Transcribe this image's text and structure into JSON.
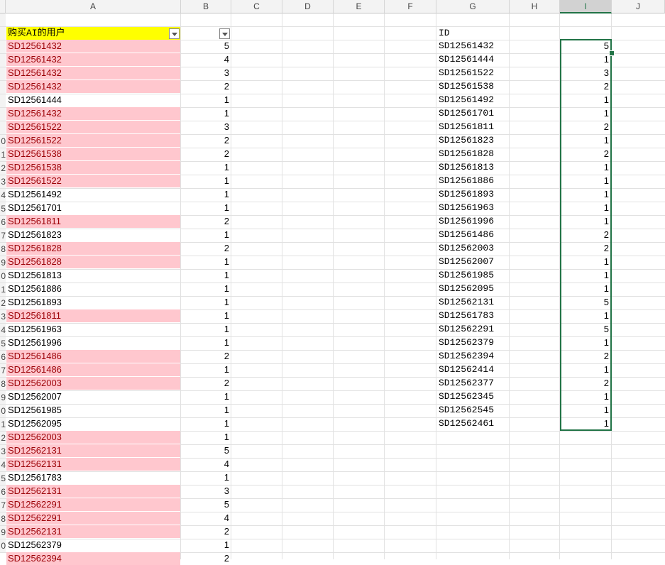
{
  "columns": [
    "A",
    "B",
    "C",
    "D",
    "E",
    "F",
    "G",
    "H",
    "I",
    "J"
  ],
  "selected_column": "I",
  "colA_header": "购买AI的用户",
  "colG_header": "ID",
  "colA_rows": [
    {
      "id": "SD12561432",
      "val": "5",
      "dup": true
    },
    {
      "id": "SD12561432",
      "val": "4",
      "dup": true
    },
    {
      "id": "SD12561432",
      "val": "3",
      "dup": true
    },
    {
      "id": "SD12561432",
      "val": "2",
      "dup": true
    },
    {
      "id": "SD12561444",
      "val": "1",
      "dup": false
    },
    {
      "id": "SD12561432",
      "val": "1",
      "dup": true
    },
    {
      "id": "SD12561522",
      "val": "3",
      "dup": true
    },
    {
      "id": "SD12561522",
      "val": "2",
      "dup": true
    },
    {
      "id": "SD12561538",
      "val": "2",
      "dup": true
    },
    {
      "id": "SD12561538",
      "val": "1",
      "dup": true
    },
    {
      "id": "SD12561522",
      "val": "1",
      "dup": true
    },
    {
      "id": "SD12561492",
      "val": "1",
      "dup": false
    },
    {
      "id": "SD12561701",
      "val": "1",
      "dup": false
    },
    {
      "id": "SD12561811",
      "val": "2",
      "dup": true
    },
    {
      "id": "SD12561823",
      "val": "1",
      "dup": false
    },
    {
      "id": "SD12561828",
      "val": "2",
      "dup": true
    },
    {
      "id": "SD12561828",
      "val": "1",
      "dup": true
    },
    {
      "id": "SD12561813",
      "val": "1",
      "dup": false
    },
    {
      "id": "SD12561886",
      "val": "1",
      "dup": false
    },
    {
      "id": "SD12561893",
      "val": "1",
      "dup": false
    },
    {
      "id": "SD12561811",
      "val": "1",
      "dup": true
    },
    {
      "id": "SD12561963",
      "val": "1",
      "dup": false
    },
    {
      "id": "SD12561996",
      "val": "1",
      "dup": false
    },
    {
      "id": "SD12561486",
      "val": "2",
      "dup": true
    },
    {
      "id": "SD12561486",
      "val": "1",
      "dup": true
    },
    {
      "id": "SD12562003",
      "val": "2",
      "dup": true
    },
    {
      "id": "SD12562007",
      "val": "1",
      "dup": false
    },
    {
      "id": "SD12561985",
      "val": "1",
      "dup": false
    },
    {
      "id": "SD12562095",
      "val": "1",
      "dup": false
    },
    {
      "id": "SD12562003",
      "val": "1",
      "dup": true
    },
    {
      "id": "SD12562131",
      "val": "5",
      "dup": true
    },
    {
      "id": "SD12562131",
      "val": "4",
      "dup": true
    },
    {
      "id": "SD12561783",
      "val": "1",
      "dup": false
    },
    {
      "id": "SD12562131",
      "val": "3",
      "dup": true
    },
    {
      "id": "SD12562291",
      "val": "5",
      "dup": true
    },
    {
      "id": "SD12562291",
      "val": "4",
      "dup": true
    },
    {
      "id": "SD12562131",
      "val": "2",
      "dup": true
    },
    {
      "id": "SD12562379",
      "val": "1",
      "dup": false
    },
    {
      "id": "SD12562394",
      "val": "2",
      "dup": true
    }
  ],
  "colG_rows": [
    {
      "id": "SD12561432",
      "val": "5"
    },
    {
      "id": "SD12561444",
      "val": "1"
    },
    {
      "id": "SD12561522",
      "val": "3"
    },
    {
      "id": "SD12561538",
      "val": "2"
    },
    {
      "id": "SD12561492",
      "val": "1"
    },
    {
      "id": "SD12561701",
      "val": "1"
    },
    {
      "id": "SD12561811",
      "val": "2"
    },
    {
      "id": "SD12561823",
      "val": "1"
    },
    {
      "id": "SD12561828",
      "val": "2"
    },
    {
      "id": "SD12561813",
      "val": "1"
    },
    {
      "id": "SD12561886",
      "val": "1"
    },
    {
      "id": "SD12561893",
      "val": "1"
    },
    {
      "id": "SD12561963",
      "val": "1"
    },
    {
      "id": "SD12561996",
      "val": "1"
    },
    {
      "id": "SD12561486",
      "val": "2"
    },
    {
      "id": "SD12562003",
      "val": "2"
    },
    {
      "id": "SD12562007",
      "val": "1"
    },
    {
      "id": "SD12561985",
      "val": "1"
    },
    {
      "id": "SD12562095",
      "val": "1"
    },
    {
      "id": "SD12562131",
      "val": "5"
    },
    {
      "id": "SD12561783",
      "val": "1"
    },
    {
      "id": "SD12562291",
      "val": "5"
    },
    {
      "id": "SD12562379",
      "val": "1"
    },
    {
      "id": "SD12562394",
      "val": "2"
    },
    {
      "id": "SD12562414",
      "val": "1"
    },
    {
      "id": "SD12562377",
      "val": "2"
    },
    {
      "id": "SD12562345",
      "val": "1"
    },
    {
      "id": "SD12562545",
      "val": "1"
    },
    {
      "id": "SD12562461",
      "val": "1"
    }
  ],
  "row_stub_labels": [
    "",
    "",
    "",
    "",
    "",
    "",
    "",
    "",
    "",
    "0",
    "1",
    "2",
    "3",
    "4",
    "5",
    "6",
    "7",
    "8",
    "9",
    "0",
    "1",
    "2",
    "3",
    "4",
    "5",
    "6",
    "7",
    "8",
    "9",
    "0",
    "1",
    "2",
    "3",
    "4",
    "5",
    "6",
    "7",
    "8",
    "9",
    "0"
  ],
  "colors": {
    "dup_fill": "#ffc7ce",
    "dup_text": "#9c0006",
    "header_fill": "#ffff00",
    "selection": "#217346"
  }
}
